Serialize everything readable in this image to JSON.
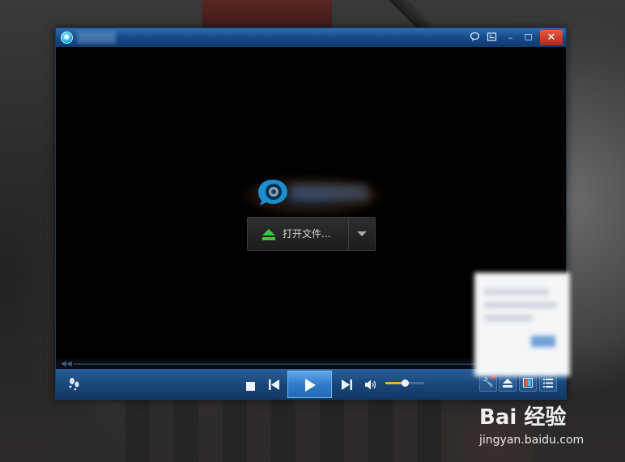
{
  "window": {
    "title": "",
    "title_buttons": {
      "chat_icon": "chat-bubble-icon",
      "skin_icon": "playlist-icon",
      "minimize": "–",
      "maximize": "☐",
      "close": "✕"
    }
  },
  "center": {
    "open_file_label": "打开文件..."
  },
  "controls": {
    "volume_level": 0.5,
    "icons": [
      "footprint-icon",
      "stop-icon",
      "previous-icon",
      "play-icon",
      "next-icon",
      "volume-icon",
      "tools-icon",
      "eject-icon",
      "skin-icon",
      "playlist-icon"
    ]
  },
  "watermark": {
    "main": "Bai 经验",
    "sub": "jingyan.baidu.com"
  },
  "colors": {
    "titlebar": "#164a86",
    "accent_play": "#2f79c8",
    "close": "#c8301f",
    "volume_fill": "#e8b23a"
  }
}
